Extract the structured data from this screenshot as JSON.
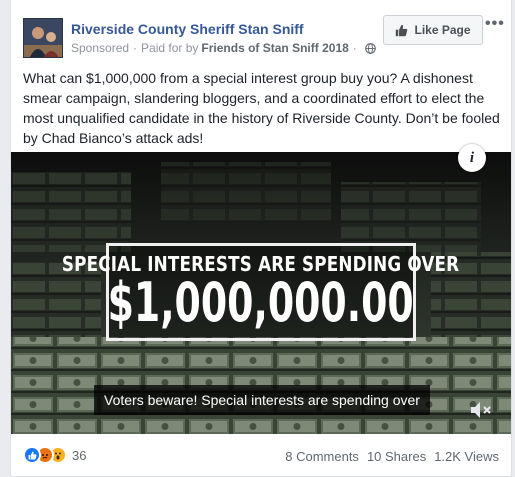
{
  "post": {
    "page_name": "Riverside County Sheriff Stan Sniff",
    "sponsored": "Sponsored",
    "paid_for_prefix": "Paid for by",
    "paid_for_by": "Friends of Stan Sniff 2018",
    "like_page_label": "Like Page",
    "text": "What can $1,000,000 from a special interest group buy you? A dishonest smear campaign, slandering bloggers, and a coordinated effort to elect the most unqualified candidate in the history of Riverside County. Don’t be fooled by Chad Bianco’s attack ads!"
  },
  "video": {
    "overlay_line1": "SPECIAL INTERESTS ARE SPENDING OVER",
    "overlay_amount": "$1,000,000.00",
    "caption": "Voters beware! Special interests are spending over",
    "info_label": "i"
  },
  "footer": {
    "reaction_count": "36",
    "comments": "8 Comments",
    "shares": "10 Shares",
    "views": "1.2K Views"
  },
  "colors": {
    "link_blue": "#365899",
    "like_blue": "#1877f2",
    "angry_orange": "#e9710f",
    "wow_yellow": "#f7b125"
  }
}
